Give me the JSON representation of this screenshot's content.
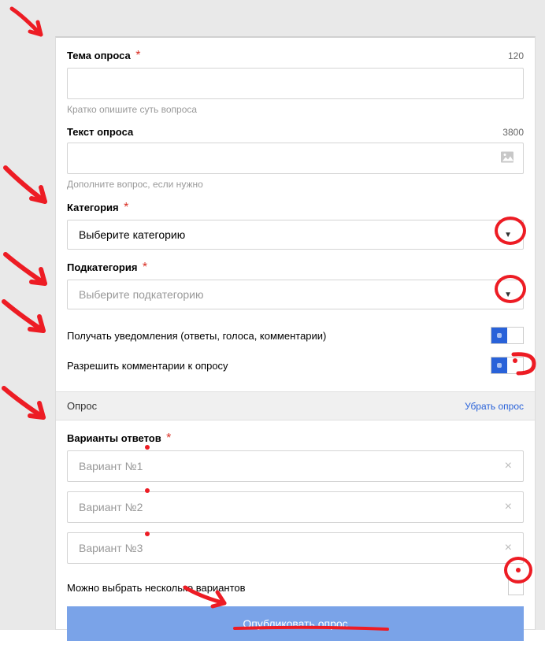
{
  "topic": {
    "label": "Тема опроса",
    "required": "*",
    "charLimit": "120",
    "value": "",
    "hint": "Кратко опишите суть вопроса"
  },
  "text": {
    "label": "Текст опроса",
    "charLimit": "3800",
    "hint": "Дополните вопрос, если нужно"
  },
  "category": {
    "label": "Категория",
    "required": "*",
    "placeholder": "Выберите категорию"
  },
  "subcategory": {
    "label": "Подкатегория",
    "required": "*",
    "placeholder": "Выберите подкатегорию"
  },
  "notifications": {
    "label": "Получать уведомления (ответы, голоса, комментарии)"
  },
  "comments": {
    "label": "Разрешить комментарии к опросу"
  },
  "pollSection": {
    "title": "Опрос",
    "removeLink": "Убрать опрос"
  },
  "answers": {
    "label": "Варианты ответов",
    "required": "*",
    "options": [
      {
        "placeholder": "Вариант №1"
      },
      {
        "placeholder": "Вариант №2"
      },
      {
        "placeholder": "Вариант №3"
      }
    ]
  },
  "multiple": {
    "label": "Можно выбрать несколько вариантов"
  },
  "submit": {
    "label": "Опубликовать опрос"
  }
}
